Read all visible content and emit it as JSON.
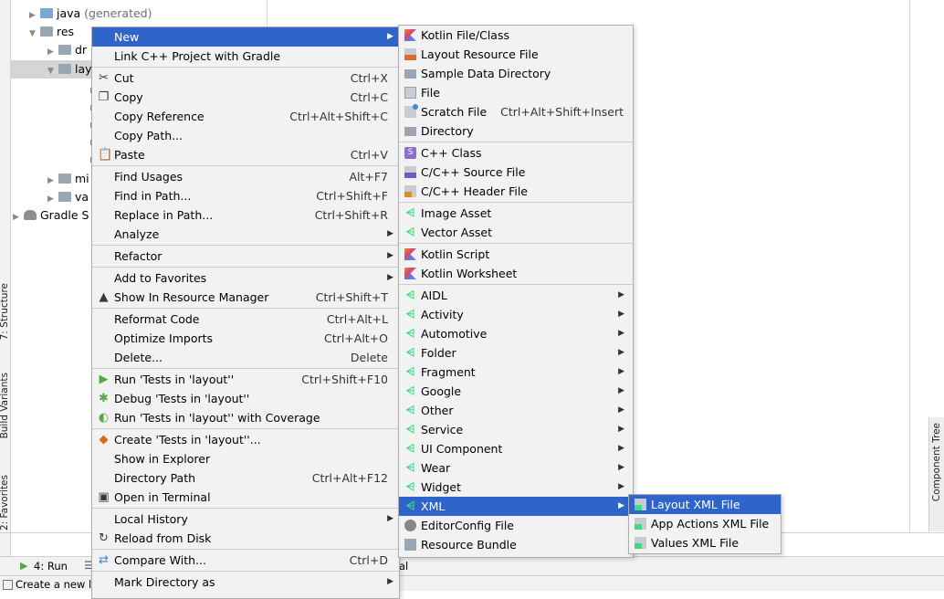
{
  "tree": {
    "items": [
      {
        "label": "java",
        "suffix": " (generated)"
      },
      {
        "label": "res"
      },
      {
        "label": "dr"
      },
      {
        "label": "lay"
      },
      {
        "label": "mi"
      },
      {
        "label": "va"
      },
      {
        "label": "Gradle S"
      }
    ]
  },
  "left_tabs": {
    "structure": "7: Structure",
    "build_variants": "Build Variants",
    "favorites": "2: Favorites"
  },
  "right_tabs": {
    "component_tree": "Component Tree"
  },
  "bottom": {
    "run_tab": "4: Run",
    "partial_tab": "al",
    "status": "Create a new l"
  },
  "context_menu": {
    "items": [
      {
        "label": "New",
        "submenu": true,
        "selected": true
      },
      {
        "label": "Link C++ Project with Gradle"
      },
      {
        "sep": true
      },
      {
        "label": "Cut",
        "shortcut": "Ctrl+X",
        "icon": "scissors-icon"
      },
      {
        "label": "Copy",
        "shortcut": "Ctrl+C",
        "icon": "copy-icon"
      },
      {
        "label": "Copy Reference",
        "shortcut": "Ctrl+Alt+Shift+C"
      },
      {
        "label": "Copy Path..."
      },
      {
        "label": "Paste",
        "shortcut": "Ctrl+V",
        "icon": "paste-icon"
      },
      {
        "sep": true
      },
      {
        "label": "Find Usages",
        "shortcut": "Alt+F7"
      },
      {
        "label": "Find in Path...",
        "shortcut": "Ctrl+Shift+F"
      },
      {
        "label": "Replace in Path...",
        "shortcut": "Ctrl+Shift+R"
      },
      {
        "label": "Analyze",
        "submenu": true
      },
      {
        "sep": true
      },
      {
        "label": "Refactor",
        "submenu": true
      },
      {
        "sep": true
      },
      {
        "label": "Add to Favorites",
        "submenu": true
      },
      {
        "label": "Show In Resource Manager",
        "shortcut": "Ctrl+Shift+T",
        "icon": "resource-manager-icon"
      },
      {
        "sep": true
      },
      {
        "label": "Reformat Code",
        "shortcut": "Ctrl+Alt+L"
      },
      {
        "label": "Optimize Imports",
        "shortcut": "Ctrl+Alt+O"
      },
      {
        "label": "Delete...",
        "shortcut": "Delete"
      },
      {
        "sep": true
      },
      {
        "label": "Run 'Tests in 'layout''",
        "shortcut": "Ctrl+Shift+F10",
        "icon": "run-icon"
      },
      {
        "label": "Debug 'Tests in 'layout''",
        "icon": "debug-icon"
      },
      {
        "label": "Run 'Tests in 'layout'' with Coverage",
        "icon": "coverage-icon"
      },
      {
        "sep": true
      },
      {
        "label": "Create 'Tests in 'layout''...",
        "icon": "create-test-icon"
      },
      {
        "label": "Show in Explorer"
      },
      {
        "label": "Directory Path",
        "shortcut": "Ctrl+Alt+F12"
      },
      {
        "label": "Open in Terminal",
        "icon": "terminal-icon"
      },
      {
        "sep": true
      },
      {
        "label": "Local History",
        "submenu": true
      },
      {
        "label": "Reload from Disk",
        "icon": "reload-icon"
      },
      {
        "sep": true
      },
      {
        "label": "Compare With...",
        "shortcut": "Ctrl+D",
        "icon": "compare-icon"
      },
      {
        "sep": true
      },
      {
        "label": "Mark Directory as",
        "submenu": true
      }
    ]
  },
  "new_menu": {
    "items": [
      {
        "label": "Kotlin File/Class",
        "icon": "kotlin-icon"
      },
      {
        "label": "Layout Resource File",
        "icon": "layout-file-icon"
      },
      {
        "label": "Sample Data Directory",
        "icon": "folder-icon"
      },
      {
        "label": "File",
        "icon": "file-icon"
      },
      {
        "label": "Scratch File",
        "shortcut": "Ctrl+Alt+Shift+Insert",
        "icon": "scratch-file-icon"
      },
      {
        "label": "Directory",
        "icon": "folder-icon"
      },
      {
        "sep": true
      },
      {
        "label": "C++ Class",
        "icon": "cpp-class-icon"
      },
      {
        "label": "C/C++ Source File",
        "icon": "cpp-source-icon"
      },
      {
        "label": "C/C++ Header File",
        "icon": "cpp-header-icon"
      },
      {
        "sep": true
      },
      {
        "label": "Image Asset",
        "icon": "android-icon"
      },
      {
        "label": "Vector Asset",
        "icon": "android-icon"
      },
      {
        "sep": true
      },
      {
        "label": "Kotlin Script",
        "icon": "kotlin-icon"
      },
      {
        "label": "Kotlin Worksheet",
        "icon": "kotlin-icon"
      },
      {
        "sep": true
      },
      {
        "label": "AIDL",
        "submenu": true,
        "icon": "android-icon"
      },
      {
        "label": "Activity",
        "submenu": true,
        "icon": "android-icon"
      },
      {
        "label": "Automotive",
        "submenu": true,
        "icon": "android-icon"
      },
      {
        "label": "Folder",
        "submenu": true,
        "icon": "android-icon"
      },
      {
        "label": "Fragment",
        "submenu": true,
        "icon": "android-icon"
      },
      {
        "label": "Google",
        "submenu": true,
        "icon": "android-icon"
      },
      {
        "label": "Other",
        "submenu": true,
        "icon": "android-icon"
      },
      {
        "label": "Service",
        "submenu": true,
        "icon": "android-icon"
      },
      {
        "label": "UI Component",
        "submenu": true,
        "icon": "android-icon"
      },
      {
        "label": "Wear",
        "submenu": true,
        "icon": "android-icon"
      },
      {
        "label": "Widget",
        "submenu": true,
        "icon": "android-icon"
      },
      {
        "label": "XML",
        "submenu": true,
        "selected": true,
        "icon": "android-icon"
      },
      {
        "label": "EditorConfig File",
        "icon": "editorconfig-icon"
      },
      {
        "label": "Resource Bundle",
        "icon": "resource-bundle-icon"
      }
    ]
  },
  "xml_menu": {
    "items": [
      {
        "label": "Layout XML File",
        "selected": true,
        "icon": "xml-file-icon"
      },
      {
        "label": "App Actions XML File",
        "icon": "xml-file-icon"
      },
      {
        "label": "Values XML File",
        "icon": "xml-file-icon"
      }
    ]
  },
  "colors": {
    "selection": "#2f65ca",
    "menu_bg": "#f2f2f2",
    "android_green": "#3ddc84"
  }
}
